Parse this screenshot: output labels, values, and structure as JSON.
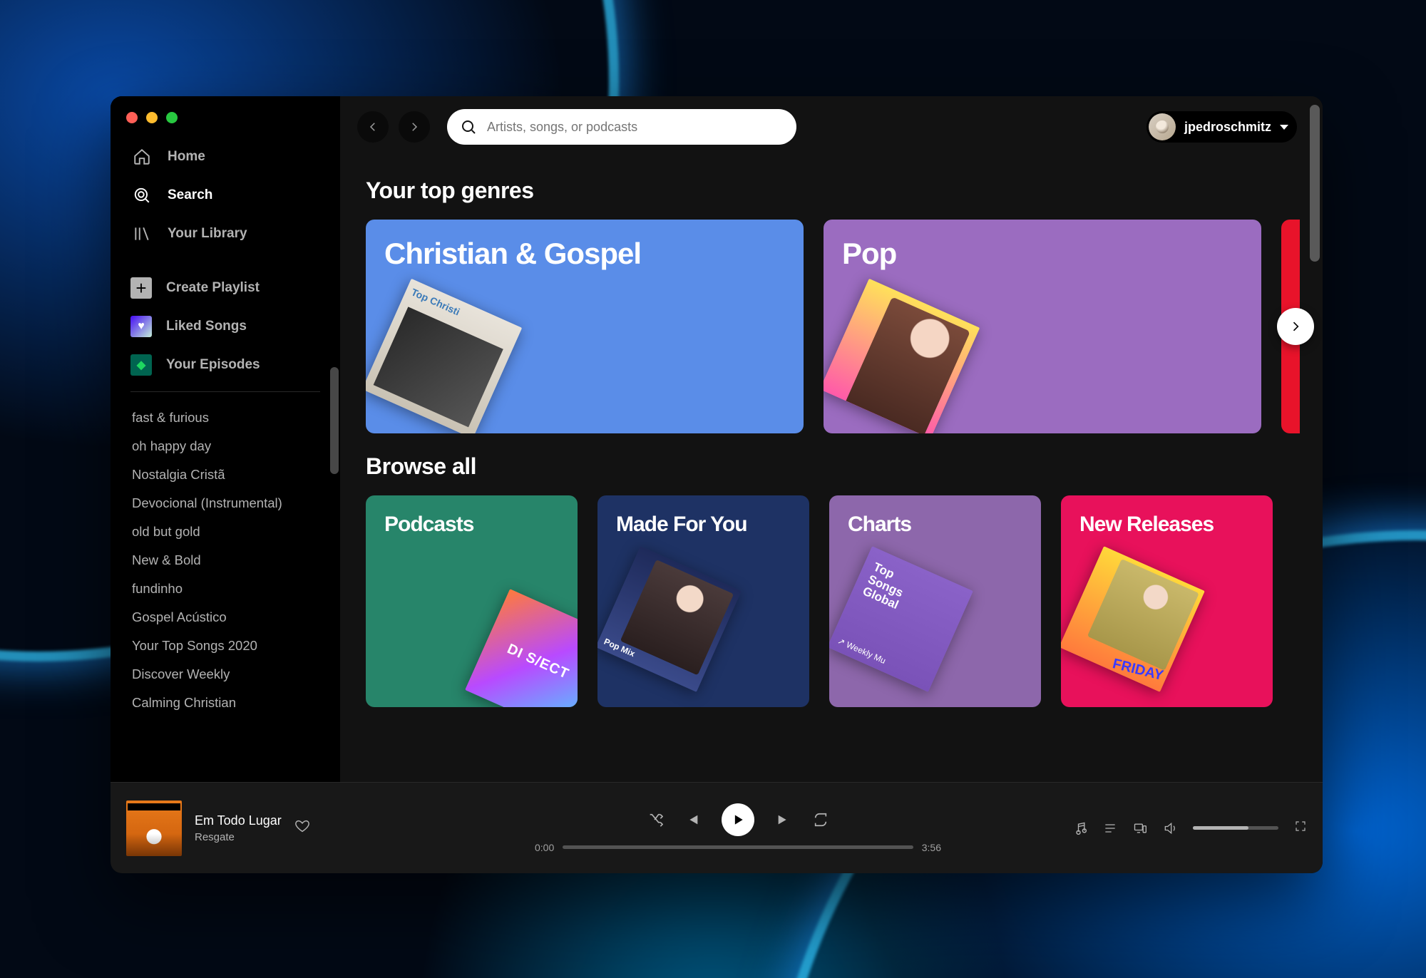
{
  "sidebar": {
    "nav": [
      {
        "label": "Home",
        "active": false
      },
      {
        "label": "Search",
        "active": true
      },
      {
        "label": "Your Library",
        "active": false
      }
    ],
    "actions": {
      "create": "Create Playlist",
      "liked": "Liked Songs",
      "episodes": "Your Episodes"
    },
    "playlists": [
      "fast & furious",
      "oh happy day",
      "Nostalgia Cristã",
      "Devocional (Instrumental)",
      "old but gold",
      "New & Bold",
      "fundinho",
      "Gospel Acústico",
      "Your Top Songs 2020",
      "Discover Weekly",
      "Calming Christian"
    ]
  },
  "header": {
    "search_placeholder": "Artists, songs, or podcasts",
    "username": "jpedroschmitz"
  },
  "sections": {
    "top_genres_title": "Your top genres",
    "browse_all_title": "Browse all"
  },
  "top_genres": [
    {
      "title": "Christian & Gospel",
      "color": "#5a8de8",
      "art": "art-gospel"
    },
    {
      "title": "Pop",
      "color": "#9b6cc0",
      "art": "art-pop"
    },
    {
      "title": "",
      "color": "#e8132a",
      "art": ""
    }
  ],
  "browse_all": [
    {
      "title": "Podcasts",
      "color": "#27856a",
      "art": "art-pod"
    },
    {
      "title": "Made For You",
      "color": "#1e3264",
      "art": "art-m4u"
    },
    {
      "title": "Charts",
      "color": "#8d67ab",
      "art": "art-charts"
    },
    {
      "title": "New Releases",
      "color": "#e8115b",
      "art": "art-new"
    }
  ],
  "player": {
    "track_title": "Em Todo Lugar",
    "track_artist": "Resgate",
    "elapsed": "0:00",
    "duration": "3:56",
    "progress_pct": 0,
    "volume_pct": 65
  }
}
